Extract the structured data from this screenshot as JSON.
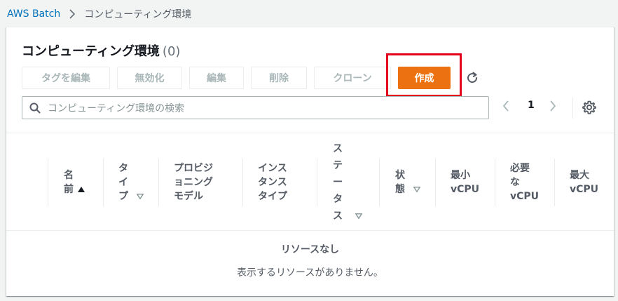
{
  "breadcrumb": {
    "root": "AWS Batch",
    "current": "コンピューティング環境"
  },
  "panel": {
    "title": "コンピューティング環境",
    "count": "(0)"
  },
  "actions": {
    "edit_tags": "タグを編集",
    "disable": "無効化",
    "edit": "編集",
    "delete": "削除",
    "clone": "クローン",
    "create": "作成"
  },
  "search": {
    "placeholder": "コンピューティング環境の検索"
  },
  "pagination": {
    "current_page": "1"
  },
  "table": {
    "columns": {
      "name": [
        "名",
        "前"
      ],
      "type": [
        "タ",
        "イ",
        "プ"
      ],
      "provisioning_model": [
        "プロビジ",
        "ョニング",
        "モデル"
      ],
      "instance_type": [
        "インス",
        "タンス",
        "タイプ"
      ],
      "status": [
        "ス",
        "テ",
        "ー",
        "タ",
        "ス"
      ],
      "state": [
        "状",
        "態"
      ],
      "min_vcpu": [
        "最小",
        "vCPU"
      ],
      "desired_vcpu": [
        "必要",
        "な",
        "vCPU"
      ],
      "max_vcpu": [
        "最大",
        "vCPU"
      ]
    },
    "empty_title": "リソースなし",
    "empty_description": "表示するリソースがありません。"
  },
  "colors": {
    "primary": "#ec7211",
    "link": "#0073bb",
    "highlight": "#e2001a"
  },
  "icons": {
    "breadcrumb_separator": "chevron-right-icon",
    "refresh": "refresh-icon",
    "search": "search-icon",
    "prev": "chevron-left-icon",
    "next": "chevron-right-icon",
    "settings": "gear-icon",
    "sort_asc": "caret-up-icon",
    "sort": "caret-down-icon"
  }
}
